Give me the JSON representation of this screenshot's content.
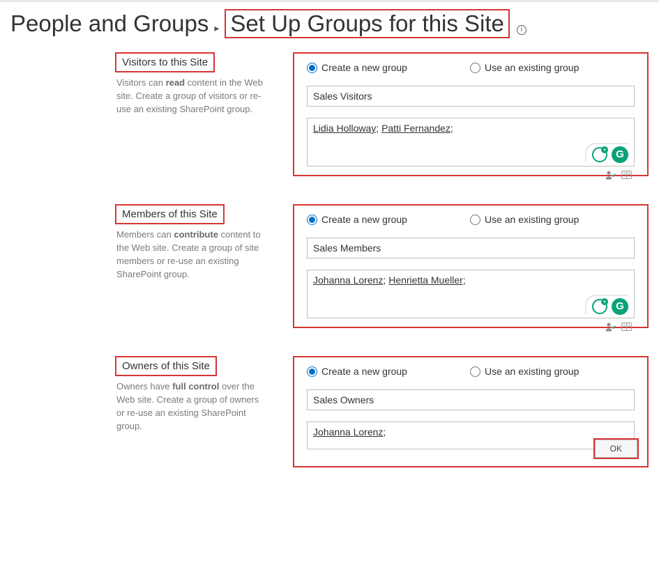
{
  "breadcrumb": {
    "parent": "People and Groups",
    "current": "Set Up Groups for this Site"
  },
  "radio_options": {
    "create": "Create a new group",
    "existing": "Use an existing group"
  },
  "sections": {
    "visitors": {
      "title": "Visitors to this Site",
      "help_prefix": "Visitors can ",
      "help_bold": "read",
      "help_suffix": " content in the Web site. Create a group of visitors or re-use an existing SharePoint group.",
      "group_name": "Sales Visitors",
      "people": [
        "Lidia Holloway",
        "Patti Fernandez"
      ],
      "radio_selected": "create"
    },
    "members": {
      "title": "Members of this Site",
      "help_prefix": "Members can ",
      "help_bold": "contribute",
      "help_suffix": " content to the Web site. Create a group of site members or re-use an existing SharePoint group.",
      "group_name": "Sales Members",
      "people": [
        "Johanna Lorenz",
        "Henrietta Mueller"
      ],
      "radio_selected": "create"
    },
    "owners": {
      "title": "Owners of this Site",
      "help_prefix": "Owners have ",
      "help_bold": "full control",
      "help_suffix": " over the Web site. Create a group of owners or re-use an existing SharePoint group.",
      "group_name": "Sales Owners",
      "people": [
        "Johanna Lorenz"
      ],
      "radio_selected": "create"
    }
  },
  "buttons": {
    "ok": "OK"
  }
}
